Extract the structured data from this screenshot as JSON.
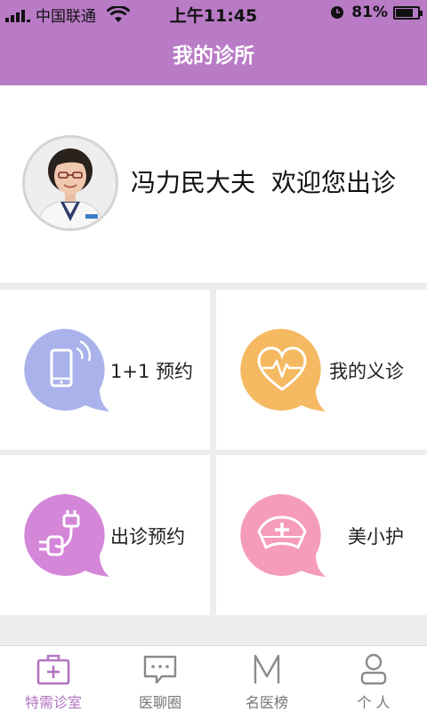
{
  "status_bar": {
    "carrier": "中国联通",
    "time": "上午11:45",
    "battery": "81%",
    "battery_level": 0.81
  },
  "header": {
    "title": "我的诊所"
  },
  "profile": {
    "doctor_name": "冯力民大夫",
    "welcome": "欢迎您出诊"
  },
  "services": [
    {
      "label": "1+1 预约",
      "color": "#a9b2ea",
      "icon": "phone-icon"
    },
    {
      "label": "我的义诊",
      "color": "#f5b961",
      "icon": "heart-pulse-icon"
    },
    {
      "label": "出诊预约",
      "color": "#d486d9",
      "icon": "stethoscope-plug-icon"
    },
    {
      "label": "美小护",
      "color": "#f59cb9",
      "icon": "nurse-cap-icon"
    }
  ],
  "tabs": [
    {
      "label": "特需诊室",
      "icon": "medical-kit-icon",
      "active": true
    },
    {
      "label": "医聊圈",
      "icon": "chat-bubble-icon",
      "active": false
    },
    {
      "label": "名医榜",
      "icon": "m-letter-icon",
      "active": false
    },
    {
      "label": "个 人",
      "icon": "person-icon",
      "active": false
    }
  ],
  "colors": {
    "brand": "#b97bc6",
    "active_tab": "#b274c0",
    "background": "#ededed"
  }
}
